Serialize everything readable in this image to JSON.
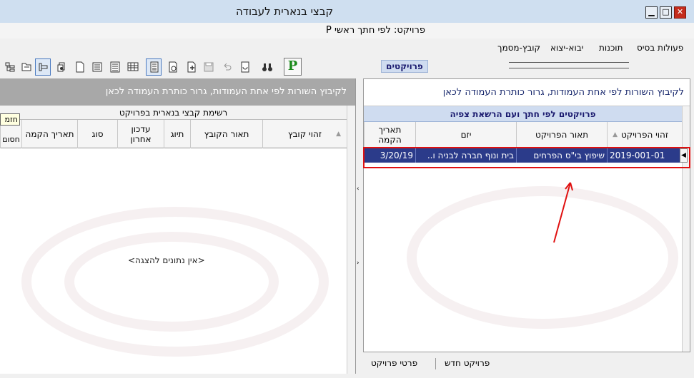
{
  "window": {
    "title": "קבצי בנארית לעבודה",
    "subtitle": "פרויקט: לפי חתך ראשי P"
  },
  "menu": [
    "קובץ-מסמך",
    "יבוא-יצוא",
    "תוכנות",
    "פעולות בסיס"
  ],
  "toolbar": {
    "p_button": "P",
    "projects_label": "פרויקטים"
  },
  "left_pane": {
    "group_hint": "לקיבוץ השורות לפי אחת העמודות, גרור כותרת העמודה לכאן",
    "caption": "רשימת קבצי בנארית בפרויקט",
    "columns": [
      "זהוי קובץ",
      "תאור הקובץ",
      "תיוג",
      "עדכון אחרון",
      "סוג",
      "תאריך הקמה",
      "חסום"
    ],
    "tooltip": "חזמ",
    "empty_text": "<אין נתונים להצגה>"
  },
  "right_pane": {
    "group_hint": "לקיבוץ השורות לפי אחת העמודות, גרור כותרת העמודה לכאן",
    "caption": "פרויקטים לפי חתך ועם הרשאת צפיה",
    "columns": [
      "זהוי הפרויקט",
      "תאור הפרויקט",
      "יזם",
      "תאריך הקמה"
    ],
    "rows": [
      {
        "id": "2019-001-01",
        "desc": "שיפוץ בי\"ס הפרחים",
        "owner": "בית ונוף חברה לבניה ו..",
        "date": "3/20/19"
      }
    ]
  },
  "bottom_buttons": [
    "פרויקט חדש",
    "פרטי פרויקט"
  ]
}
